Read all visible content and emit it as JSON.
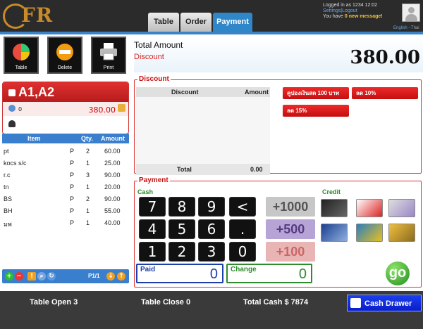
{
  "header": {
    "logo_text": "FR",
    "tabs": [
      {
        "label": "Table",
        "active": false
      },
      {
        "label": "Order",
        "active": false
      },
      {
        "label": "Payment",
        "active": true
      }
    ],
    "login_text": "Logged in as 1234 12:02",
    "settings_link": "Settings",
    "logout_link": "Logout",
    "msg_prefix": "You have",
    "msg_count": "0 new message!",
    "lang_english": "English",
    "lang_thai": "Thai"
  },
  "toolbar": {
    "table_label": "Table",
    "delete_label": "Delete",
    "print_label": "Print"
  },
  "table_info": {
    "table_name": "A1,A2",
    "guests": "0",
    "amount": "380.00"
  },
  "items": {
    "headers": {
      "item": "Item",
      "qty": "Qty.",
      "amount": "Amount"
    },
    "rows": [
      {
        "name": "pt",
        "type": "P",
        "qty": "2",
        "amount": "60.00"
      },
      {
        "name": "kocs s/c",
        "type": "P",
        "qty": "1",
        "amount": "25.00"
      },
      {
        "name": "r.c",
        "type": "P",
        "qty": "3",
        "amount": "90.00"
      },
      {
        "name": "tn",
        "type": "P",
        "qty": "1",
        "amount": "20.00"
      },
      {
        "name": "BS",
        "type": "P",
        "qty": "2",
        "amount": "90.00"
      },
      {
        "name": "BH",
        "type": "P",
        "qty": "1",
        "amount": "55.00"
      },
      {
        "name": "มพ",
        "type": "P",
        "qty": "1",
        "amount": "40.00"
      }
    ],
    "page_indicator": "P1/1"
  },
  "summary": {
    "total_label": "Total Amount",
    "discount_label": "Discount",
    "total_value": "380.00"
  },
  "discount": {
    "legend": "Discount",
    "col_discount": "Discount",
    "col_amount": "Amount",
    "total_label": "Total",
    "total_value": "0.00",
    "buttons": [
      "คูปองเงินสด 100 บาท",
      "ลด 10%",
      "ลด 15%"
    ]
  },
  "payment": {
    "legend": "Payment",
    "cash_label": "Cash",
    "credit_label": "Credit",
    "keys": [
      "7",
      "8",
      "9",
      "<",
      "4",
      "5",
      "6",
      ".",
      "1",
      "2",
      "3",
      "0"
    ],
    "quick": [
      "+1000",
      "+500",
      "+100"
    ],
    "paid_label": "Paid",
    "paid_value": "0",
    "change_label": "Change",
    "change_value": "0",
    "go_label": "go"
  },
  "footer": {
    "table_open": "Table Open 3",
    "table_close": "Table Close 0",
    "total_cash": "Total Cash $ 7874",
    "cash_drawer": "Cash Drawer"
  }
}
